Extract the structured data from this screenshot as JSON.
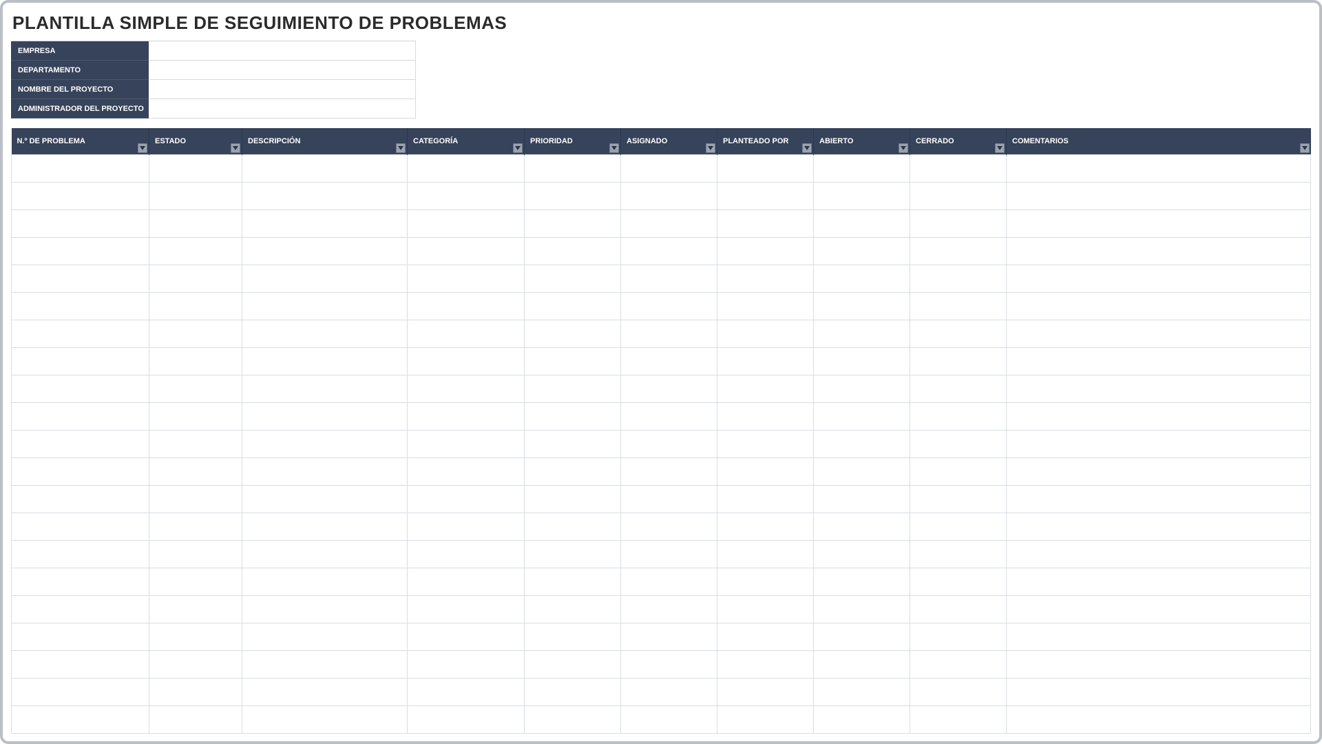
{
  "title": "PLANTILLA SIMPLE DE SEGUIMIENTO DE PROBLEMAS",
  "meta": {
    "labels": {
      "company": "EMPRESA",
      "department": "DEPARTAMENTO",
      "project_name": "NOMBRE DEL PROYECTO",
      "project_admin": "ADMINISTRADOR DEL PROYECTO"
    },
    "values": {
      "company": "",
      "department": "",
      "project_name": "",
      "project_admin": ""
    }
  },
  "columns": [
    {
      "key": "num",
      "label": "N.º DE PROBLEMA"
    },
    {
      "key": "status",
      "label": "ESTADO"
    },
    {
      "key": "desc",
      "label": "DESCRIPCIÓN"
    },
    {
      "key": "cat",
      "label": "CATEGORÍA"
    },
    {
      "key": "prio",
      "label": "PRIORIDAD"
    },
    {
      "key": "assign",
      "label": "ASIGNADO"
    },
    {
      "key": "raised",
      "label": "PLANTEADO POR"
    },
    {
      "key": "open",
      "label": "ABIERTO"
    },
    {
      "key": "closed",
      "label": "CERRADO"
    },
    {
      "key": "comments",
      "label": "COMENTARIOS"
    }
  ],
  "rows": [
    {
      "num": "",
      "status": "",
      "desc": "",
      "cat": "",
      "prio": "",
      "assign": "",
      "raised": "",
      "open": "",
      "closed": "",
      "comments": ""
    },
    {
      "num": "",
      "status": "",
      "desc": "",
      "cat": "",
      "prio": "",
      "assign": "",
      "raised": "",
      "open": "",
      "closed": "",
      "comments": ""
    },
    {
      "num": "",
      "status": "",
      "desc": "",
      "cat": "",
      "prio": "",
      "assign": "",
      "raised": "",
      "open": "",
      "closed": "",
      "comments": ""
    },
    {
      "num": "",
      "status": "",
      "desc": "",
      "cat": "",
      "prio": "",
      "assign": "",
      "raised": "",
      "open": "",
      "closed": "",
      "comments": ""
    },
    {
      "num": "",
      "status": "",
      "desc": "",
      "cat": "",
      "prio": "",
      "assign": "",
      "raised": "",
      "open": "",
      "closed": "",
      "comments": ""
    },
    {
      "num": "",
      "status": "",
      "desc": "",
      "cat": "",
      "prio": "",
      "assign": "",
      "raised": "",
      "open": "",
      "closed": "",
      "comments": ""
    },
    {
      "num": "",
      "status": "",
      "desc": "",
      "cat": "",
      "prio": "",
      "assign": "",
      "raised": "",
      "open": "",
      "closed": "",
      "comments": ""
    },
    {
      "num": "",
      "status": "",
      "desc": "",
      "cat": "",
      "prio": "",
      "assign": "",
      "raised": "",
      "open": "",
      "closed": "",
      "comments": ""
    },
    {
      "num": "",
      "status": "",
      "desc": "",
      "cat": "",
      "prio": "",
      "assign": "",
      "raised": "",
      "open": "",
      "closed": "",
      "comments": ""
    },
    {
      "num": "",
      "status": "",
      "desc": "",
      "cat": "",
      "prio": "",
      "assign": "",
      "raised": "",
      "open": "",
      "closed": "",
      "comments": ""
    },
    {
      "num": "",
      "status": "",
      "desc": "",
      "cat": "",
      "prio": "",
      "assign": "",
      "raised": "",
      "open": "",
      "closed": "",
      "comments": ""
    },
    {
      "num": "",
      "status": "",
      "desc": "",
      "cat": "",
      "prio": "",
      "assign": "",
      "raised": "",
      "open": "",
      "closed": "",
      "comments": ""
    },
    {
      "num": "",
      "status": "",
      "desc": "",
      "cat": "",
      "prio": "",
      "assign": "",
      "raised": "",
      "open": "",
      "closed": "",
      "comments": ""
    },
    {
      "num": "",
      "status": "",
      "desc": "",
      "cat": "",
      "prio": "",
      "assign": "",
      "raised": "",
      "open": "",
      "closed": "",
      "comments": ""
    },
    {
      "num": "",
      "status": "",
      "desc": "",
      "cat": "",
      "prio": "",
      "assign": "",
      "raised": "",
      "open": "",
      "closed": "",
      "comments": ""
    },
    {
      "num": "",
      "status": "",
      "desc": "",
      "cat": "",
      "prio": "",
      "assign": "",
      "raised": "",
      "open": "",
      "closed": "",
      "comments": ""
    },
    {
      "num": "",
      "status": "",
      "desc": "",
      "cat": "",
      "prio": "",
      "assign": "",
      "raised": "",
      "open": "",
      "closed": "",
      "comments": ""
    },
    {
      "num": "",
      "status": "",
      "desc": "",
      "cat": "",
      "prio": "",
      "assign": "",
      "raised": "",
      "open": "",
      "closed": "",
      "comments": ""
    },
    {
      "num": "",
      "status": "",
      "desc": "",
      "cat": "",
      "prio": "",
      "assign": "",
      "raised": "",
      "open": "",
      "closed": "",
      "comments": ""
    },
    {
      "num": "",
      "status": "",
      "desc": "",
      "cat": "",
      "prio": "",
      "assign": "",
      "raised": "",
      "open": "",
      "closed": "",
      "comments": ""
    },
    {
      "num": "",
      "status": "",
      "desc": "",
      "cat": "",
      "prio": "",
      "assign": "",
      "raised": "",
      "open": "",
      "closed": "",
      "comments": ""
    }
  ],
  "colors": {
    "header_bg": "#37435a",
    "border": "#d8dde1",
    "frame": "#b9bfc4"
  }
}
